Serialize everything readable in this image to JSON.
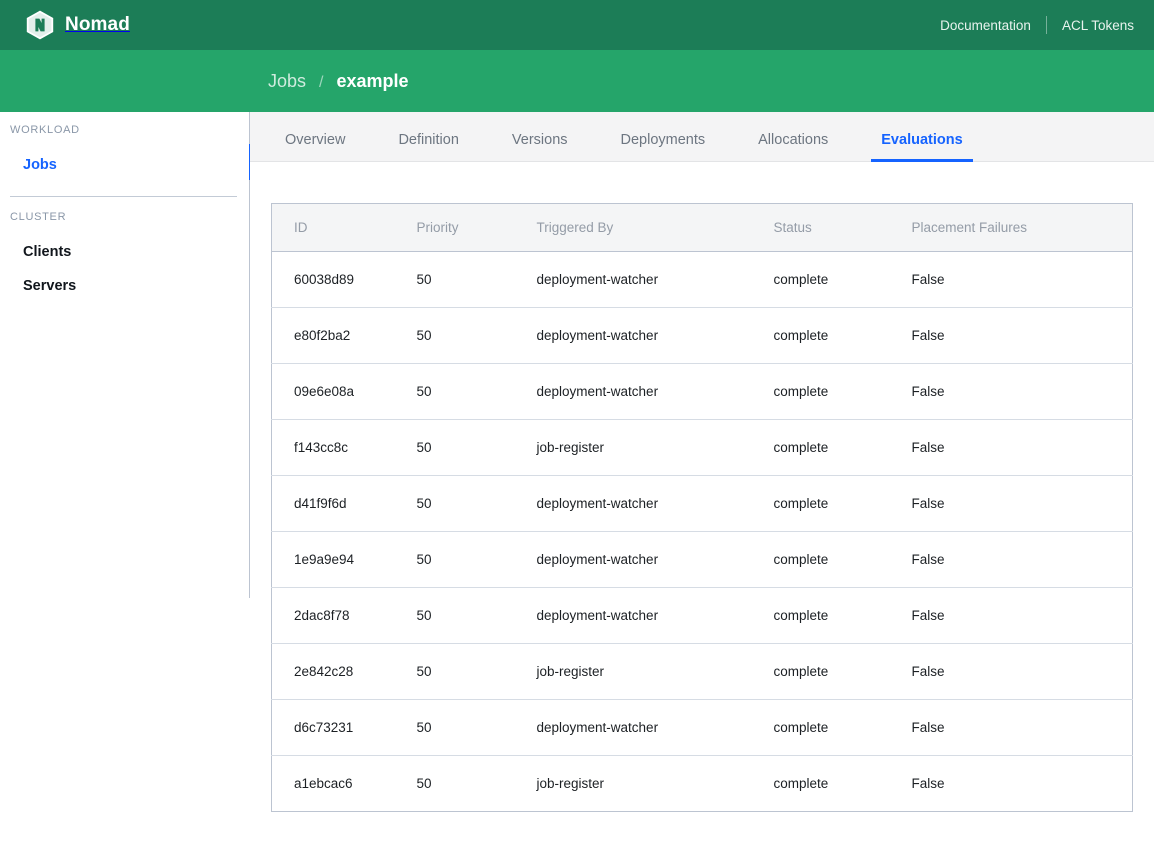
{
  "header": {
    "brand_name": "Nomad",
    "logo_icon": "nomad-hexagon-logo",
    "links": [
      {
        "label": "Documentation"
      },
      {
        "label": "ACL Tokens"
      }
    ]
  },
  "breadcrumb": {
    "parent": "Jobs",
    "separator": "/",
    "current": "example"
  },
  "sidebar": {
    "sections": [
      {
        "title": "WORKLOAD",
        "items": [
          {
            "label": "Jobs",
            "active": true
          }
        ]
      },
      {
        "title": "CLUSTER",
        "items": [
          {
            "label": "Clients",
            "active": false
          },
          {
            "label": "Servers",
            "active": false
          }
        ]
      }
    ]
  },
  "tabs": [
    {
      "label": "Overview",
      "active": false
    },
    {
      "label": "Definition",
      "active": false
    },
    {
      "label": "Versions",
      "active": false
    },
    {
      "label": "Deployments",
      "active": false
    },
    {
      "label": "Allocations",
      "active": false
    },
    {
      "label": "Evaluations",
      "active": true
    }
  ],
  "table": {
    "columns": [
      "ID",
      "Priority",
      "Triggered By",
      "Status",
      "Placement Failures"
    ],
    "rows": [
      {
        "id": "60038d89",
        "priority": "50",
        "triggered_by": "deployment-watcher",
        "status": "complete",
        "placement_failures": "False"
      },
      {
        "id": "e80f2ba2",
        "priority": "50",
        "triggered_by": "deployment-watcher",
        "status": "complete",
        "placement_failures": "False"
      },
      {
        "id": "09e6e08a",
        "priority": "50",
        "triggered_by": "deployment-watcher",
        "status": "complete",
        "placement_failures": "False"
      },
      {
        "id": "f143cc8c",
        "priority": "50",
        "triggered_by": "job-register",
        "status": "complete",
        "placement_failures": "False"
      },
      {
        "id": "d41f9f6d",
        "priority": "50",
        "triggered_by": "deployment-watcher",
        "status": "complete",
        "placement_failures": "False"
      },
      {
        "id": "1e9a9e94",
        "priority": "50",
        "triggered_by": "deployment-watcher",
        "status": "complete",
        "placement_failures": "False"
      },
      {
        "id": "2dac8f78",
        "priority": "50",
        "triggered_by": "deployment-watcher",
        "status": "complete",
        "placement_failures": "False"
      },
      {
        "id": "2e842c28",
        "priority": "50",
        "triggered_by": "job-register",
        "status": "complete",
        "placement_failures": "False"
      },
      {
        "id": "d6c73231",
        "priority": "50",
        "triggered_by": "deployment-watcher",
        "status": "complete",
        "placement_failures": "False"
      },
      {
        "id": "a1ebcac6",
        "priority": "50",
        "triggered_by": "job-register",
        "status": "complete",
        "placement_failures": "False"
      }
    ]
  },
  "colors": {
    "header_green": "#1c7d57",
    "subheader_green": "#25a56a",
    "accent_blue": "#1563ff",
    "table_header_bg": "#f4f5f6",
    "tabbar_bg": "#f4f4f5"
  }
}
